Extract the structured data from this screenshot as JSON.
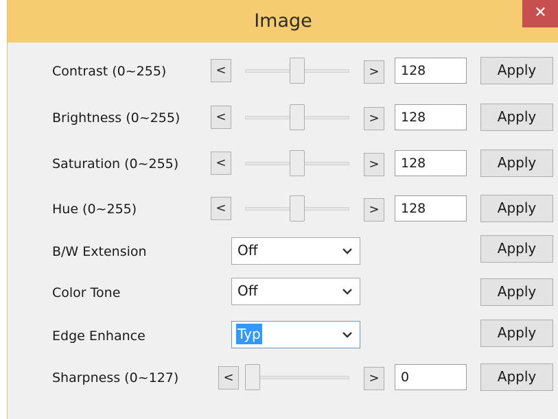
{
  "window": {
    "title": "Image",
    "close_glyph": "✕"
  },
  "slider_rows": [
    {
      "label": "Contrast (0~255)",
      "left_arrow": "<",
      "right_arrow": ">",
      "value": "128",
      "apply": "Apply",
      "level": 128,
      "max": 255
    },
    {
      "label": "Brightness (0~255)",
      "left_arrow": "<",
      "right_arrow": ">",
      "value": "128",
      "apply": "Apply",
      "level": 128,
      "max": 255
    },
    {
      "label": "Saturation (0~255)",
      "left_arrow": "<",
      "right_arrow": ">",
      "value": "128",
      "apply": "Apply",
      "level": 128,
      "max": 255
    },
    {
      "label": "Hue (0~255)",
      "left_arrow": "<",
      "right_arrow": ">",
      "value": "128",
      "apply": "Apply",
      "level": 128,
      "max": 255
    }
  ],
  "select_rows": [
    {
      "label": "B/W Extension",
      "value": "Off",
      "apply": "Apply"
    },
    {
      "label": "Color Tone",
      "value": "Off",
      "apply": "Apply"
    },
    {
      "label": "Edge Enhance",
      "value": "Typ",
      "apply": "Apply",
      "selected_text_highlight": true
    }
  ],
  "sharpness_row": {
    "label": "Sharpness (0~127)",
    "left_arrow": "<",
    "right_arrow": ">",
    "value": "0",
    "apply": "Apply",
    "level": 0,
    "max": 127
  },
  "colors": {
    "titlebar": "#f5cc6f",
    "close_button": "#c74f4f",
    "selection_highlight": "#3399ff",
    "panel": "#f0f0f0"
  }
}
